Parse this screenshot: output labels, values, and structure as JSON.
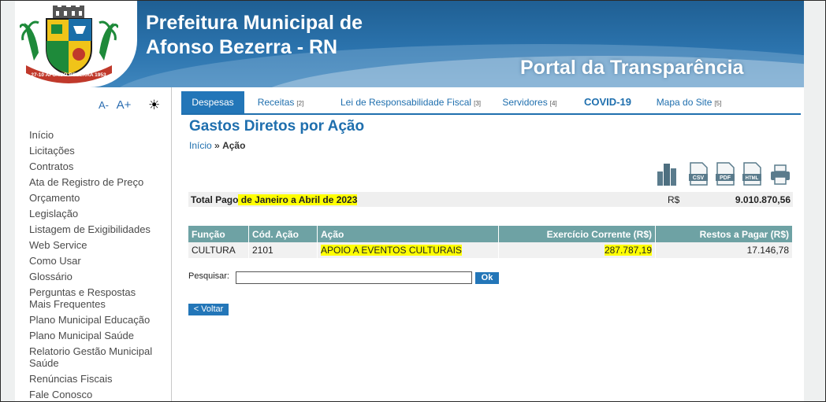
{
  "header": {
    "title_line1": "Prefeitura Municipal de",
    "title_line2": "Afonso Bezerra - RN",
    "portal": "Portal da Transparência",
    "logo_ribbon": "27-10 AFONSO BEZERRA 1953"
  },
  "sidebar": {
    "font_decrease": "A-",
    "font_increase": "A+",
    "contrast_icon": "☀",
    "items": [
      "Início",
      "Licitações",
      "Contratos",
      "Ata de Registro de Preço",
      "Orçamento",
      "Legislação",
      "Listagem de Exigibilidades",
      "Web Service",
      "Como Usar",
      "Glossário",
      "Perguntas e Respostas Mais Frequentes",
      "Plano Municipal Educação",
      "Plano Municipal Saúde",
      "Relatorio Gestão Municipal Saúde",
      "Renúncias Fiscais",
      "Fale Conosco"
    ]
  },
  "tabs": [
    {
      "label": "Despesas",
      "key": ""
    },
    {
      "label": "Receitas",
      "key": "[2]"
    },
    {
      "label": "Lei de Responsabilidade Fiscal",
      "key": "[3]"
    },
    {
      "label": "Servidores",
      "key": "[4]"
    },
    {
      "label": "COVID-19",
      "key": ""
    },
    {
      "label": "Mapa do Site",
      "key": "[5]"
    }
  ],
  "main": {
    "title": "Gastos Diretos por Ação",
    "breadcrumb_home": "Início",
    "breadcrumb_sep": "»",
    "breadcrumb_current": "Ação",
    "export_icons": [
      "bar-chart-icon",
      "csv-icon",
      "pdf-icon",
      "html-icon",
      "print-icon"
    ],
    "export_labels": {
      "csv": "CSV",
      "pdf": "PDF",
      "html": "HTML"
    },
    "total": {
      "label_prefix": "Total Pago",
      "label_highlight": " de Janeiro a Abril de 2023",
      "currency": "R$",
      "value": "9.010.870,56"
    },
    "table": {
      "headers": [
        "Função",
        "Cód. Ação",
        "Ação",
        "Exercício Corrente (R$)",
        "Restos a Pagar (R$)"
      ],
      "rows": [
        [
          "CULTURA",
          "2101",
          "APOIO A EVENTOS CULTURAIS",
          "287.787,19",
          "17.146,78"
        ]
      ]
    },
    "search_label": "Pesquisar:",
    "search_value": "",
    "ok_label": "Ok",
    "back_label": "< Voltar"
  },
  "colors": {
    "header_blue": "#2b73ad",
    "tab_active": "#2376b8",
    "link_blue": "#1f6fae",
    "table_header": "#6ea2a4",
    "highlight": "#ffff00"
  }
}
